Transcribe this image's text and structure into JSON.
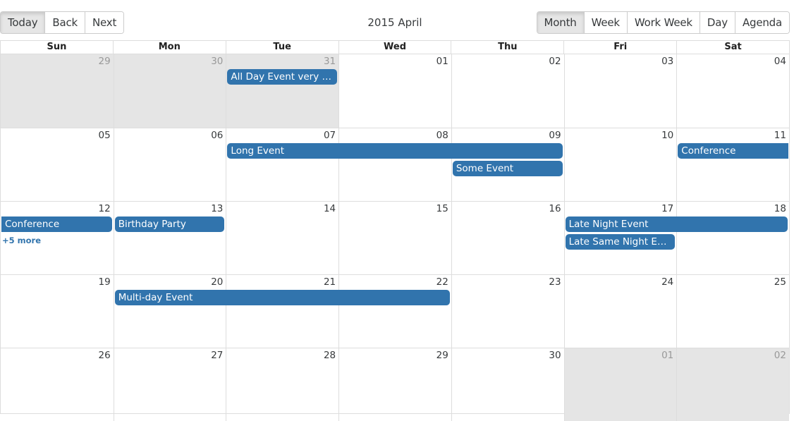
{
  "toolbar": {
    "nav_buttons": [
      {
        "label": "Today",
        "active": true
      },
      {
        "label": "Back",
        "active": false
      },
      {
        "label": "Next",
        "active": false
      }
    ],
    "title": "2015 April",
    "view_buttons": [
      {
        "label": "Month",
        "active": true
      },
      {
        "label": "Week",
        "active": false
      },
      {
        "label": "Work Week",
        "active": false
      },
      {
        "label": "Day",
        "active": false
      },
      {
        "label": "Agenda",
        "active": false
      }
    ]
  },
  "colors": {
    "event": "#3174ad",
    "off_range": "#e5e5e5",
    "border": "#dddddd"
  },
  "weekdays": [
    "Sun",
    "Mon",
    "Tue",
    "Wed",
    "Thu",
    "Fri",
    "Sat"
  ],
  "weeks": [
    {
      "days": [
        {
          "date": "29",
          "off": true
        },
        {
          "date": "30",
          "off": true
        },
        {
          "date": "31",
          "off": true
        },
        {
          "date": "01",
          "off": false
        },
        {
          "date": "02",
          "off": false
        },
        {
          "date": "03",
          "off": false
        },
        {
          "date": "04",
          "off": false
        }
      ],
      "events": [
        {
          "title": "All Day Event very lon...",
          "start": 2,
          "span": 1,
          "row": 0
        }
      ]
    },
    {
      "days": [
        {
          "date": "05",
          "off": false
        },
        {
          "date": "06",
          "off": false
        },
        {
          "date": "07",
          "off": false
        },
        {
          "date": "08",
          "off": false
        },
        {
          "date": "09",
          "off": false
        },
        {
          "date": "10",
          "off": false
        },
        {
          "date": "11",
          "off": false
        }
      ],
      "events": [
        {
          "title": "Long Event",
          "start": 2,
          "span": 3,
          "row": 0
        },
        {
          "title": "Some Event",
          "start": 4,
          "span": 1,
          "row": 1
        },
        {
          "title": "Conference",
          "start": 6,
          "span": 1,
          "row": 0,
          "continues_right": true
        }
      ]
    },
    {
      "days": [
        {
          "date": "12",
          "off": false
        },
        {
          "date": "13",
          "off": false
        },
        {
          "date": "14",
          "off": false
        },
        {
          "date": "15",
          "off": false
        },
        {
          "date": "16",
          "off": false
        },
        {
          "date": "17",
          "off": false
        },
        {
          "date": "18",
          "off": false
        }
      ],
      "events": [
        {
          "title": "Conference",
          "start": 0,
          "span": 1,
          "row": 0,
          "continues_left": true
        },
        {
          "title": "Birthday Party",
          "start": 1,
          "span": 1,
          "row": 0
        },
        {
          "title": "Late Night Event",
          "start": 5,
          "span": 2,
          "row": 0
        },
        {
          "title": "Late Same Night Event",
          "start": 5,
          "span": 1,
          "row": 1
        }
      ],
      "more": [
        {
          "label": "+5 more",
          "day": 0
        }
      ]
    },
    {
      "days": [
        {
          "date": "19",
          "off": false
        },
        {
          "date": "20",
          "off": false
        },
        {
          "date": "21",
          "off": false
        },
        {
          "date": "22",
          "off": false
        },
        {
          "date": "23",
          "off": false
        },
        {
          "date": "24",
          "off": false
        },
        {
          "date": "25",
          "off": false
        }
      ],
      "events": [
        {
          "title": "Multi-day Event",
          "start": 1,
          "span": 3,
          "row": 0
        }
      ]
    },
    {
      "days": [
        {
          "date": "26",
          "off": false
        },
        {
          "date": "27",
          "off": false
        },
        {
          "date": "28",
          "off": false
        },
        {
          "date": "29",
          "off": false
        },
        {
          "date": "30",
          "off": false
        },
        {
          "date": "01",
          "off": true
        },
        {
          "date": "02",
          "off": true
        }
      ],
      "events": []
    }
  ]
}
